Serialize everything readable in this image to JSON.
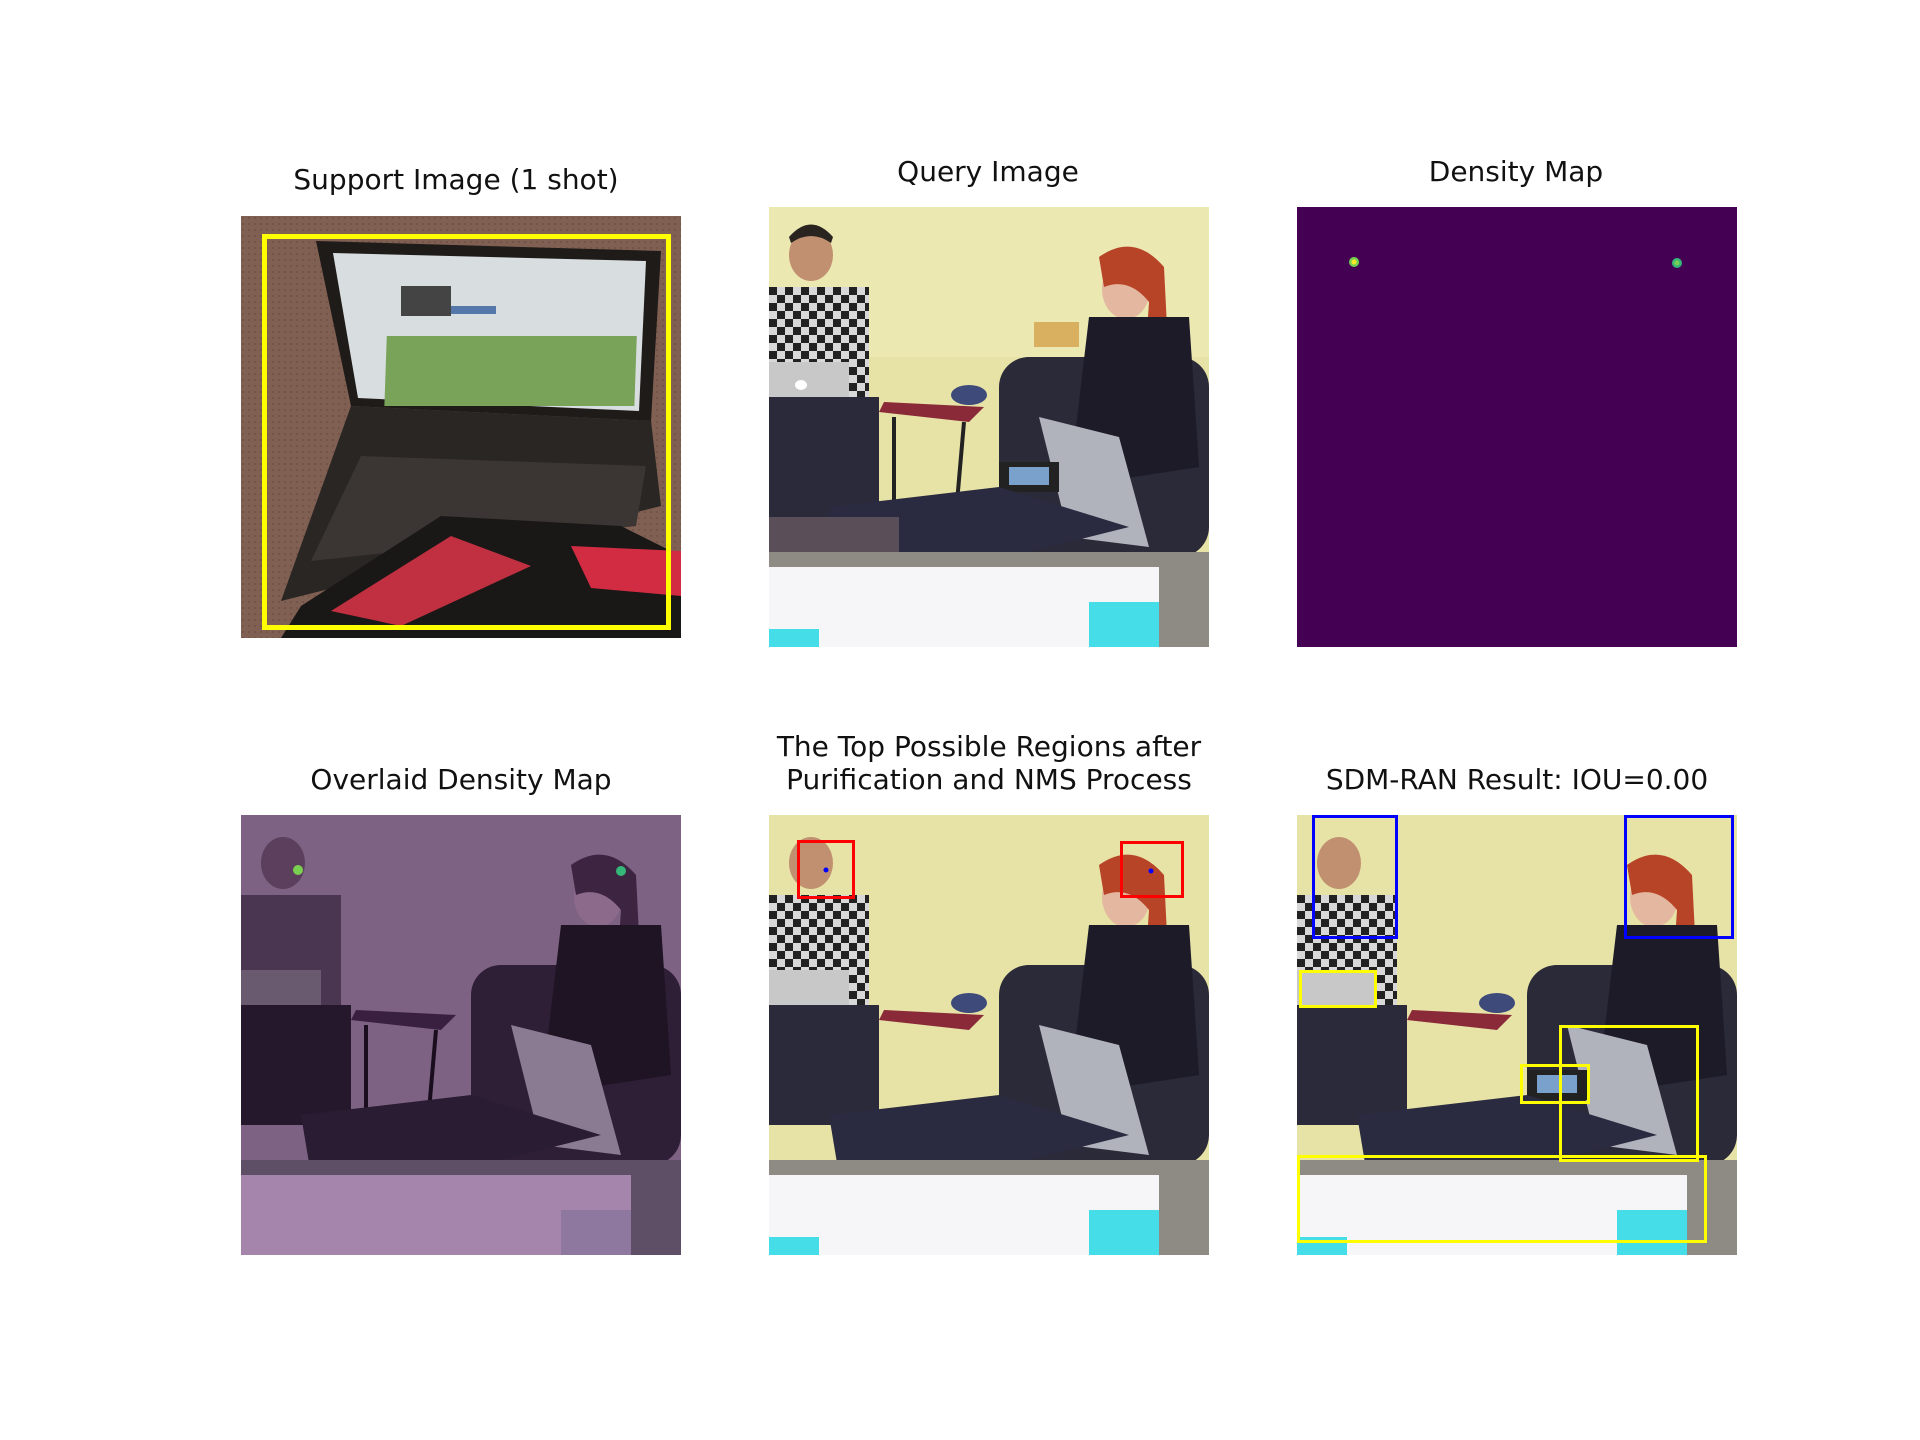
{
  "figure": {
    "panels": [
      {
        "title": "Support Image (1 shot)",
        "kind": "support-image"
      },
      {
        "title": "Query Image",
        "kind": "query-image"
      },
      {
        "title": "Density Map",
        "kind": "density-map"
      },
      {
        "title": "Overlaid Density Map",
        "kind": "overlaid-density-map"
      },
      {
        "title_lines": [
          "The Top Possible Regions after",
          "Purification and NMS Process"
        ],
        "kind": "top-regions"
      },
      {
        "title": "SDM-RAN Result: IOU=0.00",
        "kind": "result"
      }
    ]
  },
  "colors": {
    "support_box": "#ffff00",
    "density_background": "#440154",
    "density_peak": "#7ad151",
    "region_box": "#ff0000",
    "region_dot": "#0000ff",
    "result_blue_box": "#0000ff",
    "result_yellow_box": "#ffff00"
  }
}
